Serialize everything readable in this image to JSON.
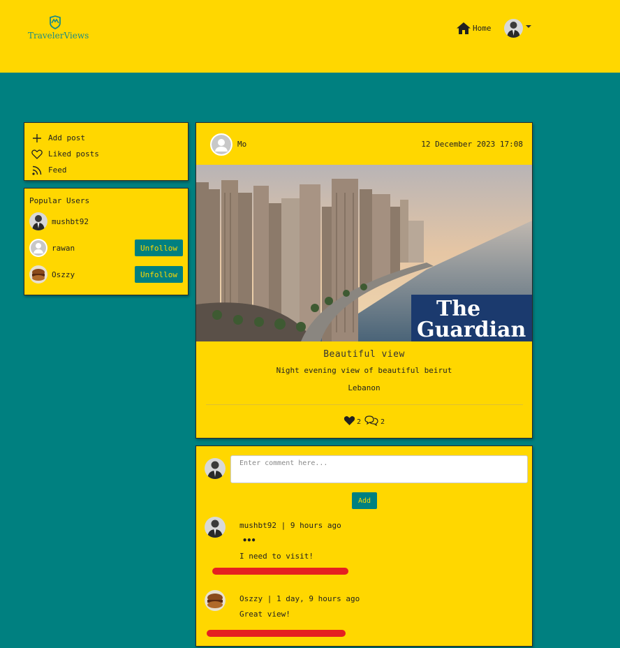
{
  "brand": {
    "name": "TravelerViews"
  },
  "nav": {
    "home_label": "Home"
  },
  "side_menu": {
    "items": [
      {
        "label": "Add post",
        "icon": "plus-icon"
      },
      {
        "label": "Liked posts",
        "icon": "heart-outline-icon"
      },
      {
        "label": "Feed",
        "icon": "rss-feed-icon"
      }
    ]
  },
  "popular_users": {
    "title": "Popular Users",
    "users": [
      {
        "name": "mushbt92",
        "button": ""
      },
      {
        "name": "rawan",
        "button": "Unfollow"
      },
      {
        "name": "Oszzy",
        "button": "Unfollow"
      }
    ]
  },
  "post": {
    "author": "Mo",
    "date": "12 December 2023 17:08",
    "image_watermark": [
      "The",
      "Guardian"
    ],
    "title": "Beautiful view",
    "description": "Night evening view of beautiful beirut",
    "location": "Lebanon",
    "likes": "2",
    "comments": "2"
  },
  "comments_section": {
    "placeholder": "Enter comment here...",
    "add_label": "Add",
    "comments": [
      {
        "user": "mushbt92",
        "time": "| 9 hours ago",
        "text": "I need to visit!",
        "menu": "•••"
      },
      {
        "user": "Oszzy",
        "time": "| 1 day, 9 hours ago",
        "text": "Great view!"
      }
    ]
  },
  "colors": {
    "accent": "#FFD700",
    "background": "#008080",
    "button": "#008080",
    "annotation": "#E52020"
  }
}
